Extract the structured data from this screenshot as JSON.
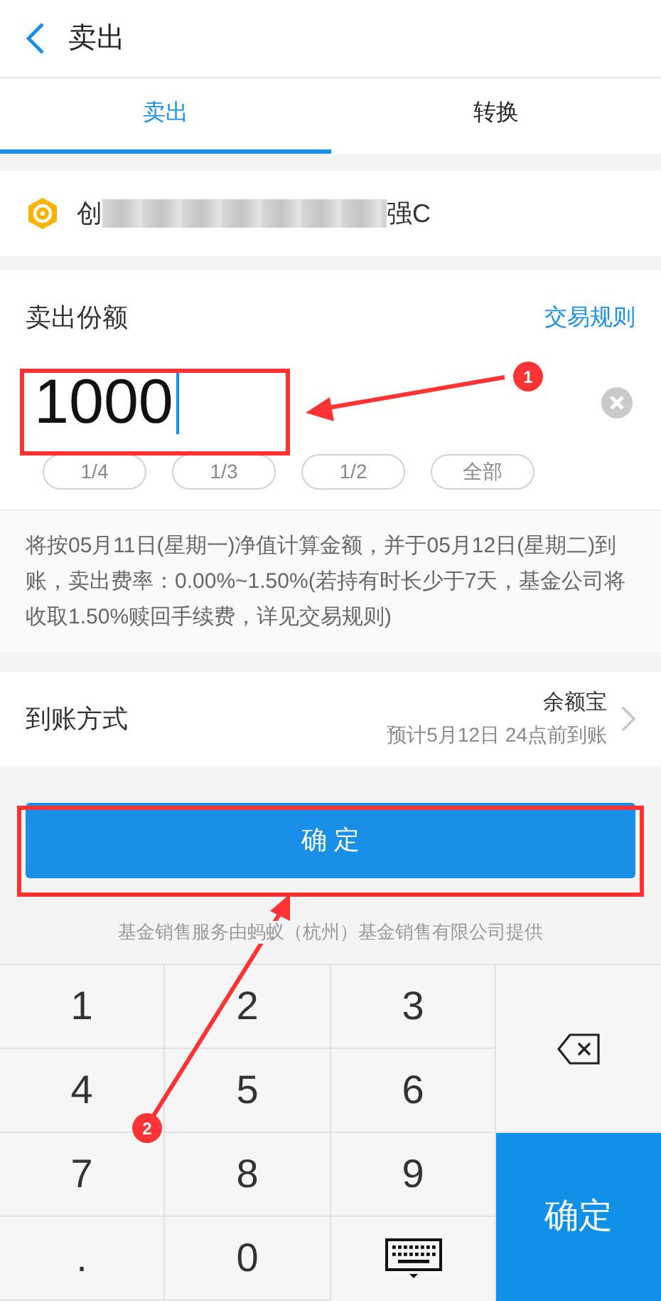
{
  "header": {
    "title": "卖出"
  },
  "tabs": [
    {
      "label": "卖出",
      "selected": true
    },
    {
      "label": "转换",
      "selected": false
    }
  ],
  "fund": {
    "name_start": "创",
    "name_end": "强C"
  },
  "amount": {
    "label": "卖出份额",
    "rules_link": "交易规则",
    "value": "1000",
    "quick_options": [
      "1/4",
      "1/3",
      "1/2",
      "全部"
    ]
  },
  "note": "将按05月11日(星期一)净值计算金额，并于05月12日(星期二)到账，卖出费率：0.00%~1.50%(若持有时长少于7天，基金公司将收取1.50%赎回手续费，详见交易规则)",
  "arrival": {
    "label": "到账方式",
    "method": "余额宝",
    "eta": "预计5月12日 24点前到账"
  },
  "confirm_button": "确 定",
  "footer": "基金销售服务由蚂蚁（杭州）基金销售有限公司提供",
  "keypad": [
    {
      "kind": "digit",
      "label": "1"
    },
    {
      "kind": "digit",
      "label": "2"
    },
    {
      "kind": "digit",
      "label": "3"
    },
    {
      "kind": "backspace"
    },
    {
      "kind": "digit",
      "label": "4"
    },
    {
      "kind": "digit",
      "label": "5"
    },
    {
      "kind": "digit",
      "label": "6"
    },
    {
      "kind": "digit",
      "label": "7"
    },
    {
      "kind": "digit",
      "label": "8"
    },
    {
      "kind": "digit",
      "label": "9"
    },
    {
      "kind": "confirm",
      "label": "确定"
    },
    {
      "kind": "digit",
      "label": "."
    },
    {
      "kind": "digit",
      "label": "0"
    },
    {
      "kind": "hide-keyboard"
    }
  ],
  "annotations": [
    {
      "label": "1"
    },
    {
      "label": "2"
    }
  ]
}
